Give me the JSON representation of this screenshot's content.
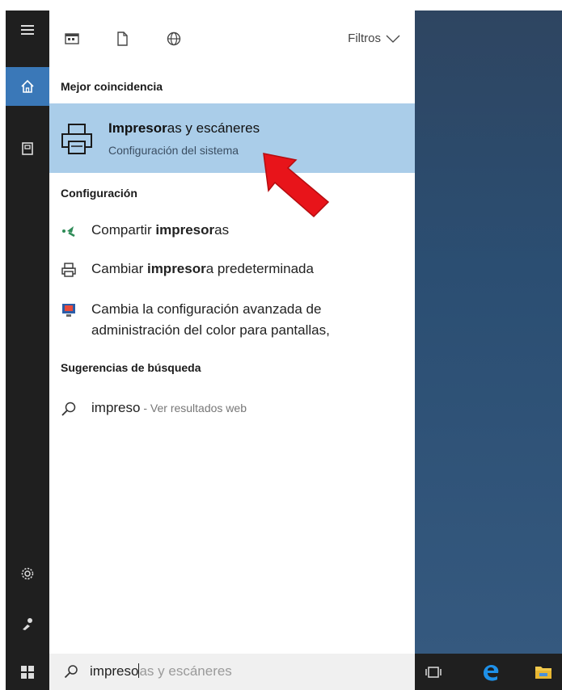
{
  "filter_bar": {
    "icons": [
      "apps-icon",
      "document-icon",
      "web-globe-icon"
    ],
    "filter_label": "Filtros"
  },
  "best_match": {
    "header": "Mejor coincidencia",
    "title_bold": "Impresor",
    "title_rest": "as y escáneres",
    "subtitle": "Configuración del sistema",
    "icon": "printer-icon",
    "highlight_color": "#aacde9"
  },
  "settings": {
    "header": "Configuración",
    "items": [
      {
        "icon": "share-printer-icon",
        "pre": "Compartir ",
        "bold": "impresor",
        "post": "as"
      },
      {
        "icon": "printer-small-icon",
        "pre": "Cambiar ",
        "bold": "impresor",
        "post": "a predeterminada"
      },
      {
        "icon": "monitor-color-icon",
        "line1": "Cambia la configuración avanzada de",
        "line2": "administración del color para pantallas,"
      }
    ]
  },
  "suggestions": {
    "header": "Sugerencias de búsqueda",
    "items": [
      {
        "icon": "search-icon",
        "term": "impreso",
        "hint": " - Ver resultados web"
      }
    ]
  },
  "search": {
    "typed": "impreso",
    "autocomplete": "as y escáneres"
  },
  "rail": {
    "items": [
      "hamburger-menu-icon",
      "home-icon",
      "notebook-icon",
      "settings-gear-icon",
      "feedback-icon"
    ]
  },
  "taskbar": {
    "icons": [
      "windows-start-icon",
      "task-view-icon",
      "edge-browser-icon",
      "file-explorer-icon"
    ]
  },
  "colors": {
    "rail_bg": "#1f1f1f",
    "accent": "#3a78b8",
    "arrow": "#e8141a"
  }
}
